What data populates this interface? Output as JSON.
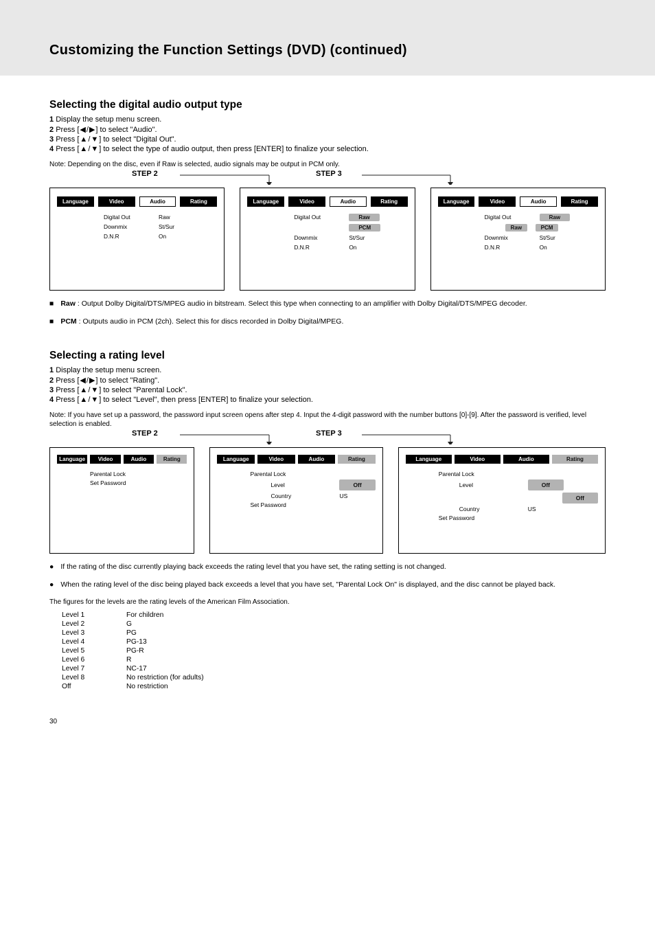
{
  "header": {
    "title": "Customizing the Function Settings (DVD) (continued)"
  },
  "sectionA": {
    "heading": "Selecting the digital audio output type",
    "steps": {
      "s1": "Display the setup menu screen.",
      "s2_pre": "Press [",
      "s2_post": "] to select \"Audio\".",
      "s3_pre": "Press [",
      "s3_post": "] to select \"Digital Out\".",
      "s4_pre": "Press [",
      "s4_post": "] to select the type of audio output, then press [ENTER] to finalize your selection."
    },
    "note": "Note: Depending on the disc, even if Raw is selected, audio signals may be output in PCM only.",
    "stepLabels": {
      "step2": "STEP 2",
      "step3": "STEP 3"
    },
    "panel": {
      "tabs": {
        "language": "Language",
        "video": "Video",
        "audio": "Audio",
        "rating": "Rating"
      },
      "menu": {
        "digitalOut": "Digital Out",
        "downmix": "Downmix",
        "dnr": "D.N.R",
        "raw": "Raw",
        "stsur": "St/Sur",
        "on": "On",
        "pcm": "PCM"
      }
    },
    "options": {
      "raw": "Raw",
      "raw_desc": "Output Dolby Digital/DTS/MPEG audio in bitstream. Select this type when connecting to an amplifier with Dolby Digital/DTS/MPEG decoder.",
      "pcm": "PCM",
      "pcm_desc": "Outputs audio in PCM (2ch). Select this for discs recorded in Dolby Digital/MPEG."
    }
  },
  "sectionB": {
    "heading": "Selecting a rating level",
    "steps": {
      "s1": "Display the setup menu screen.",
      "s2_pre": "Press [",
      "s2_post": "] to select \"Rating\".",
      "s3_pre": "Press [",
      "s3_post": "] to select \"Parental Lock\".",
      "s4_pre": "Press [",
      "s4_post": "] to select \"Level\", then press [ENTER] to finalize your selection."
    },
    "note": "Note: If you have set up a password, the password input screen opens after step 4. Input the 4-digit password with the number buttons [0]-[9]. After the password is verified, level selection is enabled.",
    "stepLabels": {
      "step2": "STEP 2",
      "step3": "STEP 3"
    },
    "panel": {
      "tabs": {
        "language": "Language",
        "video": "Video",
        "audio": "Audio",
        "rating": "Rating"
      },
      "menu": {
        "parentalLock": "Parental Lock",
        "setPassword": "Set Password",
        "level": "Level",
        "country": "Country",
        "off": "Off",
        "us": "US"
      }
    },
    "bullets": {
      "b1": "If the rating of the disc currently playing back exceeds the rating level that you have set, the rating setting is not changed.",
      "b2": "When the rating level of the disc being played back exceeds a level that you have set, \"Parental Lock On\" is displayed, and the disc cannot be played back."
    },
    "legend": {
      "intro": "The figures for the levels are the rating levels of the American Film Association."
    },
    "levels": {
      "l1": {
        "k": "Level 1",
        "v": "For children"
      },
      "l2": {
        "k": "Level 2",
        "v": "G"
      },
      "l3": {
        "k": "Level 3",
        "v": "PG"
      },
      "l4": {
        "k": "Level 4",
        "v": "PG-13"
      },
      "l5": {
        "k": "Level 5",
        "v": "PG-R"
      },
      "l6": {
        "k": "Level 6",
        "v": "R"
      },
      "l7": {
        "k": "Level 7",
        "v": "NC-17"
      },
      "l8": {
        "k": "Level 8",
        "v": "No restriction (for adults)"
      },
      "off": {
        "k": "Off",
        "v": "No restriction"
      }
    }
  },
  "pageNum": "30"
}
